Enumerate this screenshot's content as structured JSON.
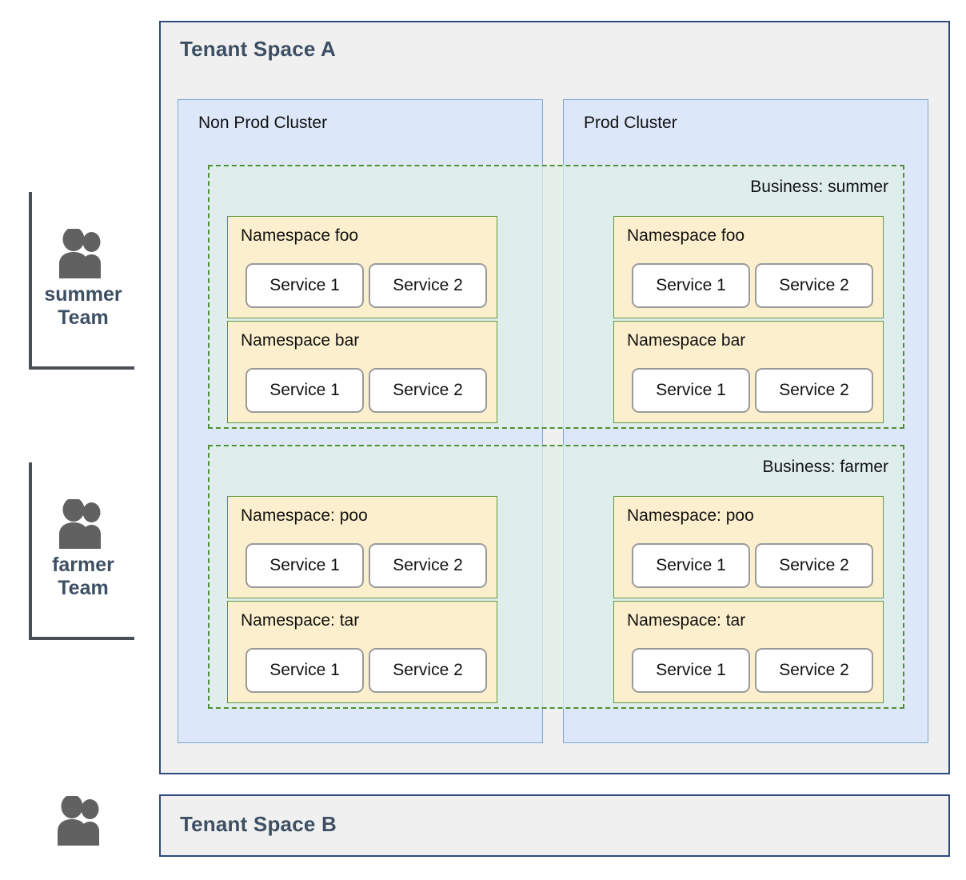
{
  "teams": [
    {
      "icon": "people-icon",
      "name": "summer",
      "suffix": "Team"
    },
    {
      "icon": "people-icon",
      "name": "farmer",
      "suffix": "Team"
    },
    {
      "icon": "people-icon",
      "name": "",
      "suffix": ""
    }
  ],
  "tenants": [
    {
      "title": "Tenant Space A"
    },
    {
      "title": "Tenant Space B"
    }
  ],
  "clusters": [
    {
      "title": "Non Prod Cluster"
    },
    {
      "title": "Prod Cluster"
    }
  ],
  "businesses": [
    {
      "label": "Business: summer",
      "namespaces": [
        {
          "title": "Namespace foo",
          "services": [
            "Service 1",
            "Service 2"
          ]
        },
        {
          "title": "Namespace bar",
          "services": [
            "Service 1",
            "Service 2"
          ]
        },
        {
          "title": "Namespace foo",
          "services": [
            "Service 1",
            "Service 2"
          ]
        },
        {
          "title": "Namespace bar",
          "services": [
            "Service 1",
            "Service 2"
          ]
        }
      ]
    },
    {
      "label": "Business: farmer",
      "namespaces": [
        {
          "title": "Namespace: poo",
          "services": [
            "Service 1",
            "Service 2"
          ]
        },
        {
          "title": "Namespace: tar",
          "services": [
            "Service 1",
            "Service 2"
          ]
        },
        {
          "title": "Namespace: poo",
          "services": [
            "Service 1",
            "Service 2"
          ]
        },
        {
          "title": "Namespace: tar",
          "services": [
            "Service 1",
            "Service 2"
          ]
        }
      ]
    }
  ],
  "colors": {
    "tenant_border": "#2f4a7c",
    "tenant_fill": "#f0f0f0",
    "tenant_title": "#3d4f63",
    "cluster_border": "#7ba7d7",
    "cluster_fill": "#dce8fa",
    "business_border": "#4f8f35",
    "business_fill": "#e5f0ec",
    "namespace_border": "#5f9a3f",
    "namespace_fill": "#fcefcd",
    "service_border": "#9a9a9a",
    "service_fill": "#ffffff",
    "team_bracket": "#4a4f57",
    "team_icon": "#616161"
  }
}
